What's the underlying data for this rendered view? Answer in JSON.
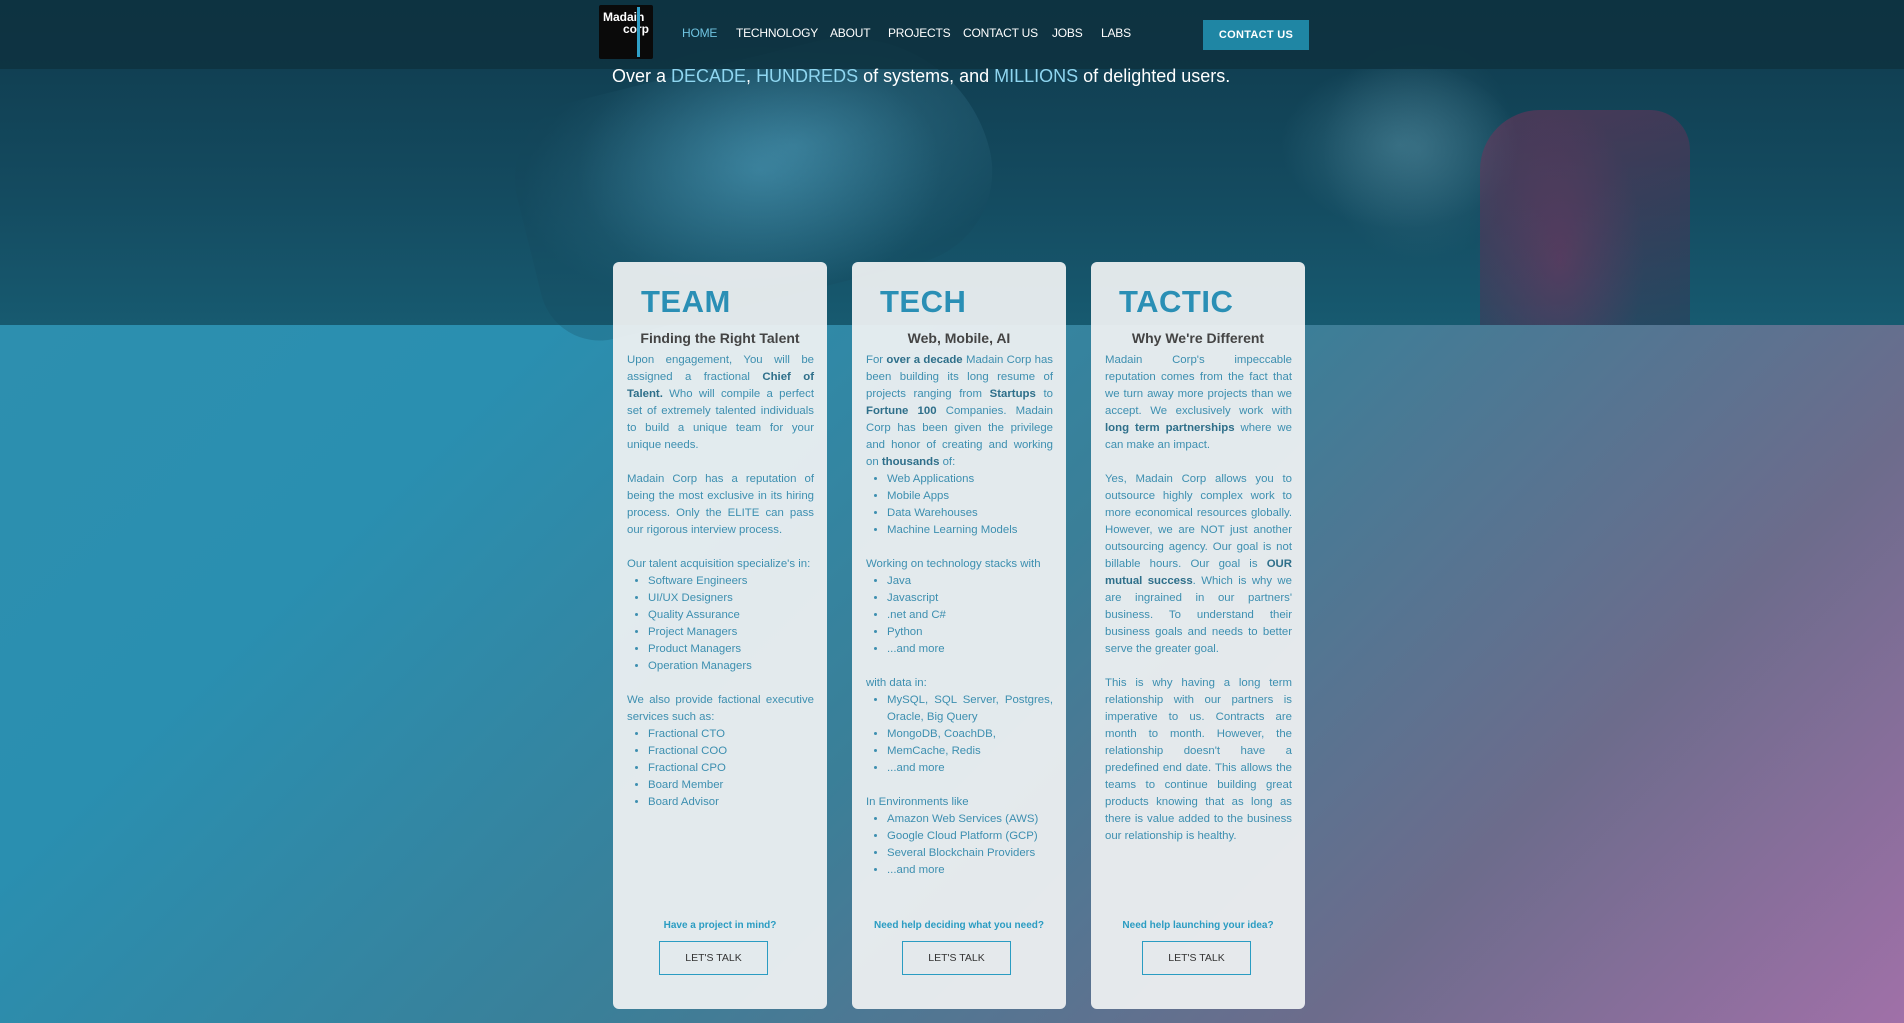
{
  "nav": {
    "logo_line1": "Madain",
    "logo_line2": "corp",
    "items": [
      {
        "label": "HOME",
        "active": true
      },
      {
        "label": "TECHNOLOGY"
      },
      {
        "label": "ABOUT"
      },
      {
        "label": "PROJECTS"
      },
      {
        "label": "CONTACT US"
      },
      {
        "label": "JOBS"
      },
      {
        "label": "LABS"
      }
    ],
    "cta_label": "CONTACT US"
  },
  "hero": {
    "tag_1": "Over a ",
    "tag_decade": "DECADE",
    "tag_2": ", ",
    "tag_hundreds": "HUNDREDS",
    "tag_3": " of systems, and ",
    "tag_millions": "MILLIONS",
    "tag_4": " of delighted users."
  },
  "cards": [
    {
      "title": "TEAM",
      "subtitle": "Finding the Right Talent",
      "p1_a": "Upon engagement, You will be assigned a fractional ",
      "p1_b": "Chief of Talent.",
      "p1_c": " Who will compile a perfect set of extremely talented individuals to build a unique team for your unique needs.",
      "p2": "Madain Corp has a reputation of being the most exclusive in its hiring process. Only the ELITE can pass our rigorous interview process.",
      "p3": "Our talent acquisition specialize's in:",
      "list1": [
        "Software Engineers",
        "UI/UX Designers",
        "Quality Assurance",
        "Project Managers",
        "Product Managers",
        "Operation Managers"
      ],
      "p4": "We also provide factional executive services such as:",
      "list2": [
        "Fractional CTO",
        "Fractional COO",
        "Fractional CPO",
        "Board Member",
        "Board Advisor"
      ],
      "ask": "Have a project in mind?",
      "button": "LET'S TALK"
    },
    {
      "title": "TECH",
      "subtitle": "Web, Mobile, AI",
      "p1_a": "For ",
      "p1_b": "over a decade",
      "p1_c": " Madain Corp has been building its long resume of projects ranging from ",
      "p1_d": "Startups",
      "p1_e": " to ",
      "p1_f": "Fortune 100",
      "p1_g": " Companies. Madain Corp has been given the privilege and honor of creating and working on ",
      "p1_h": "thousands",
      "p1_i": " of:",
      "list1": [
        "Web Applications",
        "Mobile Apps",
        "Data Warehouses",
        "Machine Learning Models"
      ],
      "p2": "Working on technology stacks with",
      "list2": [
        "Java",
        "Javascript",
        ".net and C#",
        "Python",
        "...and more"
      ],
      "p3": "with data in:",
      "list3": [
        "MySQL, SQL Server, Postgres, Oracle, Big Query",
        "MongoDB, CoachDB,",
        "MemCache, Redis",
        "...and more"
      ],
      "p4": "In Environments like",
      "list4": [
        "Amazon Web Services (AWS)",
        "Google Cloud Platform (GCP)",
        "Several Blockchain Providers",
        "...and more"
      ],
      "ask": "Need help deciding what you need?",
      "button": "LET'S TALK"
    },
    {
      "title": "TACTIC",
      "subtitle": "Why We're Different",
      "p1_a": "Madain Corp's impeccable reputation comes from the fact that we turn away more projects than we accept. We exclusively work with ",
      "p1_b": "long term partnerships",
      "p1_c": " where we can make an impact.",
      "p2_a": "Yes, Madain Corp allows you to outsource highly complex work to more economical resources globally. However, we are NOT just another outsourcing agency. Our goal is not billable hours. Our goal is ",
      "p2_b": "OUR mutual success",
      "p2_c": ". Which is why we are ingrained in our partners' business. To understand their business goals and needs to better serve the greater goal.",
      "p3": "This is why having a long term relationship with our partners is imperative to us. Contracts are month to month. However, the relationship doesn't have a predefined end date. This allows the teams to continue building great products knowing that as long as there is value added to the business our relationship is healthy.",
      "ask": "Need help launching your idea?",
      "button": "LET'S TALK"
    }
  ]
}
